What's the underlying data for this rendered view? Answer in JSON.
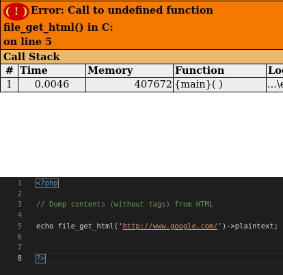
{
  "error": {
    "icon_text": "( ! )",
    "message": "Error: Call to undefined function file_get_html() in C:",
    "message_tail": "on line 5"
  },
  "call_stack": {
    "title": "Call Stack",
    "columns": [
      "#",
      "Time",
      "Memory",
      "Function",
      "Loc"
    ],
    "rows": [
      {
        "num": "1",
        "time": "0.0046",
        "memory": "407672",
        "function": "{main}( )",
        "location": "...\\e"
      }
    ]
  },
  "editor": {
    "lines": [
      {
        "number": "1",
        "tokens": [
          {
            "type": "tag",
            "text": "<?php"
          }
        ]
      },
      {
        "number": "2",
        "tokens": []
      },
      {
        "number": "3",
        "tokens": [
          {
            "type": "comment",
            "text": "// Dump contents (without tags) from HTML"
          }
        ]
      },
      {
        "number": "4",
        "tokens": []
      },
      {
        "number": "5",
        "tokens": [
          {
            "type": "plain",
            "text": "echo file_get_html("
          },
          {
            "type": "plain",
            "text": "'"
          },
          {
            "type": "str",
            "text": "http://www.google.com/"
          },
          {
            "type": "plain",
            "text": "'"
          },
          {
            "type": "plain",
            "text": ")->plaintext;"
          }
        ]
      },
      {
        "number": "6",
        "tokens": []
      },
      {
        "number": "7",
        "tokens": []
      },
      {
        "number": "8",
        "tokens": [
          {
            "type": "tag",
            "text": "?>"
          }
        ]
      }
    ],
    "active_line": "8",
    "colors": {
      "background": "#1e1e1e",
      "keyword": "#569cd6",
      "comment": "#6a9955",
      "string": "#ce9178",
      "text": "#d4d4d4"
    }
  },
  "theme": {
    "error_orange": "#f57900",
    "callstack_tan": "#e9b96e",
    "row_gray": "#eeeeec",
    "bang_red": "#cc0000",
    "bang_yellow": "#fce94f"
  }
}
